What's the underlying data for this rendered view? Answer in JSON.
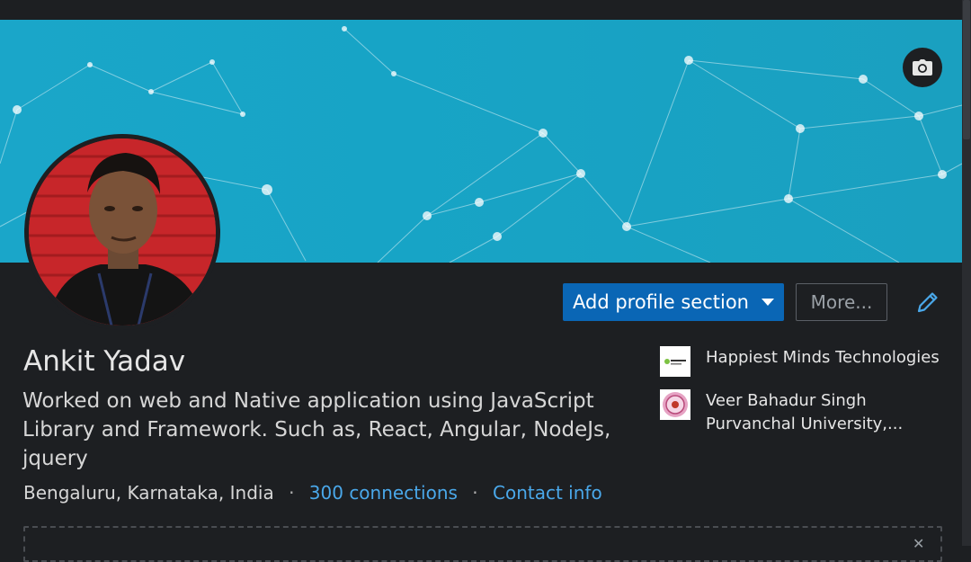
{
  "profile": {
    "name": "Ankit Yadav",
    "headline": "Worked on web and Native application using JavaScript Library and Framework. Such as, React, Angular, NodeJs, jquery",
    "location": "Bengaluru, Karnataka, India",
    "connections": "300 connections",
    "contact_info": "Contact info",
    "separator": "·"
  },
  "actions": {
    "add_section_label": "Add profile section",
    "more_label": "More..."
  },
  "organizations": [
    {
      "name": "Happiest Minds Technologies",
      "icon": "company-logo"
    },
    {
      "name": "Veer Bahadur Singh Purvanchal University,...",
      "icon": "university-logo"
    }
  ],
  "colors": {
    "background": "#1d1f22",
    "banner": "#1aa6c9",
    "primary_button": "#0a66b5",
    "link": "#4aa8ea",
    "text": "#e6e6e6"
  }
}
